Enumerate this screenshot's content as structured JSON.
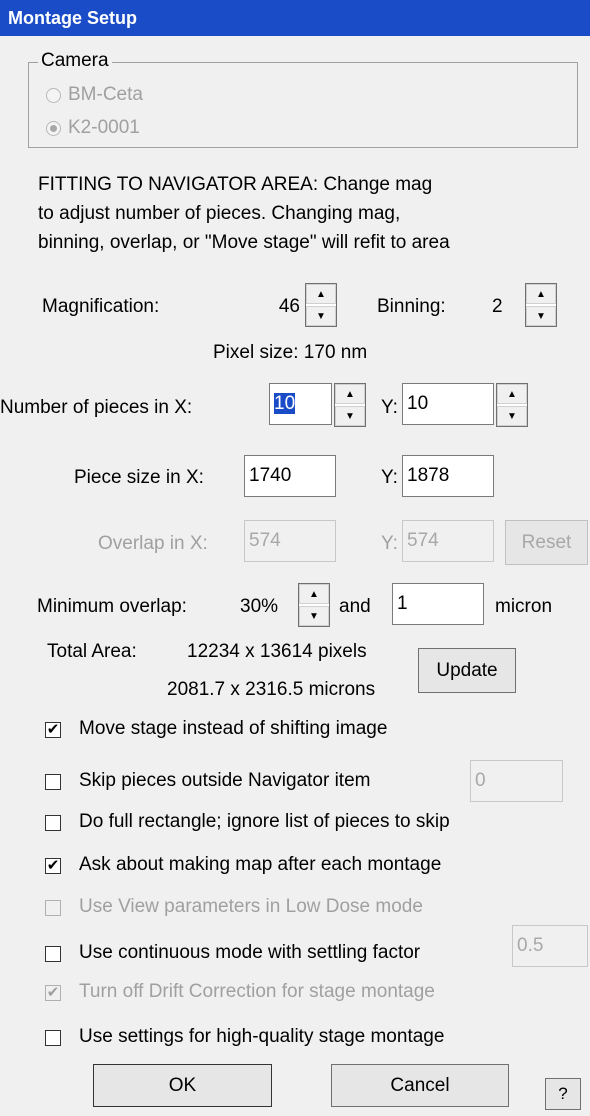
{
  "window": {
    "title": "Montage Setup"
  },
  "camera": {
    "label": "Camera",
    "options": [
      {
        "label": "BM-Ceta",
        "selected": false,
        "enabled": false
      },
      {
        "label": "K2-0001",
        "selected": true,
        "enabled": false
      }
    ]
  },
  "info": {
    "line1": "FITTING TO NAVIGATOR AREA: Change mag",
    "line2": "to adjust number of pieces.  Changing mag,",
    "line3": "binning, overlap, or \"Move stage\" will refit to area"
  },
  "magnification": {
    "label": "Magnification:",
    "value": "46"
  },
  "binning": {
    "label": "Binning:",
    "value": "2"
  },
  "pixel_size": "Pixel size: 170 nm",
  "pieces": {
    "label_x": "Number of pieces in X:",
    "x": "10",
    "label_y": "Y:",
    "y": "10"
  },
  "piece_size": {
    "label_x": "Piece size in X:",
    "x": "1740",
    "label_y": "Y:",
    "y": "1878"
  },
  "overlap": {
    "label_x": "Overlap in X:",
    "x": "574",
    "label_y": "Y:",
    "y": "574",
    "reset_label": "Reset"
  },
  "min_overlap": {
    "label": "Minimum overlap:",
    "percent": "30%",
    "and": "and",
    "value": "1",
    "unit": "micron"
  },
  "total_area": {
    "label": "Total Area:",
    "pixels": "12234 x 13614 pixels",
    "microns": "2081.7 x 2316.5 microns",
    "update_label": "Update"
  },
  "options": [
    {
      "label": "Move stage instead of shifting image",
      "checked": true,
      "enabled": true
    },
    {
      "label": "Skip pieces outside Navigator item",
      "checked": false,
      "enabled": true,
      "field": "0"
    },
    {
      "label": "Do full rectangle; ignore list of pieces to skip",
      "checked": false,
      "enabled": true
    },
    {
      "label": "Ask about making map after each montage",
      "checked": true,
      "enabled": true
    },
    {
      "label": "Use View parameters in Low Dose mode",
      "checked": false,
      "enabled": false
    },
    {
      "label": "Use continuous mode with settling factor",
      "checked": false,
      "enabled": true,
      "field": "0.5"
    },
    {
      "label": "Turn off Drift Correction for stage montage",
      "checked": true,
      "enabled": false
    },
    {
      "label": "Use settings for high-quality stage montage",
      "checked": false,
      "enabled": true
    }
  ],
  "buttons": {
    "ok": "OK",
    "cancel": "Cancel",
    "help": "?"
  }
}
